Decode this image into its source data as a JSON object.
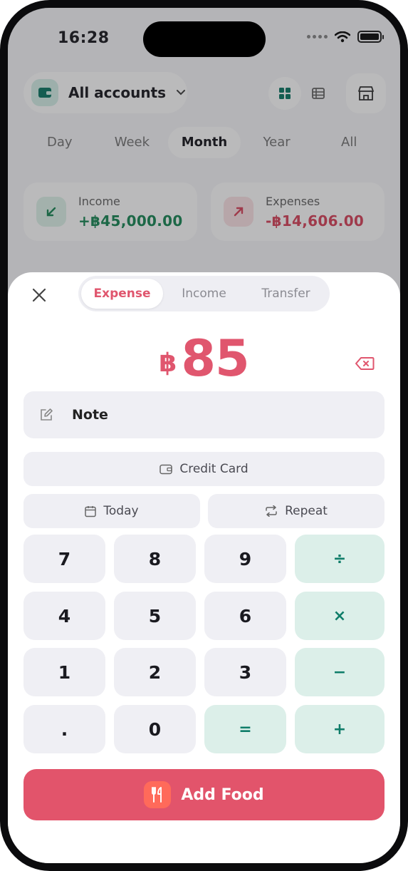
{
  "status": {
    "time": "16:28"
  },
  "header": {
    "account_label": "All accounts",
    "icons": [
      "wallet-icon",
      "chevron-down-icon",
      "grid-view-icon",
      "list-view-icon",
      "store-icon"
    ]
  },
  "periods": [
    "Day",
    "Week",
    "Month",
    "Year",
    "All"
  ],
  "active_period": "Month",
  "summary": {
    "income": {
      "label": "Income",
      "value": "+฿45,000.00",
      "color": "#1f8a5a"
    },
    "expenses": {
      "label": "Expenses",
      "value": "-฿14,606.00",
      "color": "#d9485f"
    }
  },
  "sheet": {
    "tabs": [
      "Expense",
      "Income",
      "Transfer"
    ],
    "active_tab": "Expense",
    "amount": {
      "currency": "฿",
      "value": "85"
    },
    "note_label": "Note",
    "account_button": "Credit Card",
    "date_button": "Today",
    "repeat_button": "Repeat",
    "keys": {
      "k7": "7",
      "k8": "8",
      "k9": "9",
      "div": "÷",
      "k4": "4",
      "k5": "5",
      "k6": "6",
      "mul": "×",
      "k1": "1",
      "k2": "2",
      "k3": "3",
      "sub": "−",
      "dot": ".",
      "k0": "0",
      "eq": "=",
      "add": "+"
    },
    "submit_label": "Add Food"
  },
  "colors": {
    "accent": "#e2546b",
    "operator_bg": "#dcefe9",
    "operator_text": "#0f7d69"
  }
}
